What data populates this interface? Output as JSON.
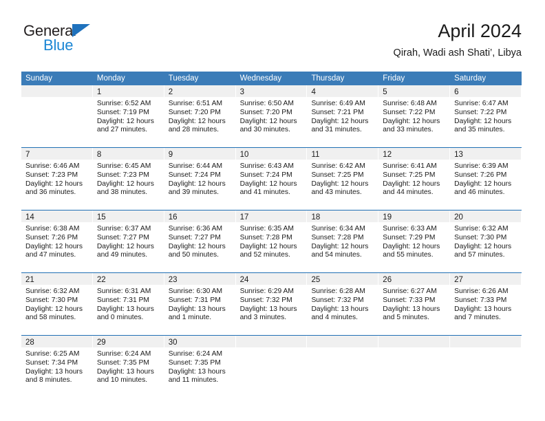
{
  "brand": {
    "name_top": "General",
    "name_bottom": "Blue",
    "triangle_color": "#1f72bd",
    "blue_text_color": "#1b86d4"
  },
  "header": {
    "title": "April 2024",
    "subtitle": "Qirah, Wadi ash Shati’, Libya"
  },
  "theme": {
    "header_bg": "#3b7cb8",
    "week_separator": "#1f6fb4",
    "day_band_bg": "#f0f0f0",
    "text": "#1a1a1a"
  },
  "weekdays": [
    "Sunday",
    "Monday",
    "Tuesday",
    "Wednesday",
    "Thursday",
    "Friday",
    "Saturday"
  ],
  "weeks": [
    [
      {
        "day": "",
        "lines": []
      },
      {
        "day": "1",
        "lines": [
          "Sunrise: 6:52 AM",
          "Sunset: 7:19 PM",
          "Daylight: 12 hours",
          "and 27 minutes."
        ]
      },
      {
        "day": "2",
        "lines": [
          "Sunrise: 6:51 AM",
          "Sunset: 7:20 PM",
          "Daylight: 12 hours",
          "and 28 minutes."
        ]
      },
      {
        "day": "3",
        "lines": [
          "Sunrise: 6:50 AM",
          "Sunset: 7:20 PM",
          "Daylight: 12 hours",
          "and 30 minutes."
        ]
      },
      {
        "day": "4",
        "lines": [
          "Sunrise: 6:49 AM",
          "Sunset: 7:21 PM",
          "Daylight: 12 hours",
          "and 31 minutes."
        ]
      },
      {
        "day": "5",
        "lines": [
          "Sunrise: 6:48 AM",
          "Sunset: 7:22 PM",
          "Daylight: 12 hours",
          "and 33 minutes."
        ]
      },
      {
        "day": "6",
        "lines": [
          "Sunrise: 6:47 AM",
          "Sunset: 7:22 PM",
          "Daylight: 12 hours",
          "and 35 minutes."
        ]
      }
    ],
    [
      {
        "day": "7",
        "lines": [
          "Sunrise: 6:46 AM",
          "Sunset: 7:23 PM",
          "Daylight: 12 hours",
          "and 36 minutes."
        ]
      },
      {
        "day": "8",
        "lines": [
          "Sunrise: 6:45 AM",
          "Sunset: 7:23 PM",
          "Daylight: 12 hours",
          "and 38 minutes."
        ]
      },
      {
        "day": "9",
        "lines": [
          "Sunrise: 6:44 AM",
          "Sunset: 7:24 PM",
          "Daylight: 12 hours",
          "and 39 minutes."
        ]
      },
      {
        "day": "10",
        "lines": [
          "Sunrise: 6:43 AM",
          "Sunset: 7:24 PM",
          "Daylight: 12 hours",
          "and 41 minutes."
        ]
      },
      {
        "day": "11",
        "lines": [
          "Sunrise: 6:42 AM",
          "Sunset: 7:25 PM",
          "Daylight: 12 hours",
          "and 43 minutes."
        ]
      },
      {
        "day": "12",
        "lines": [
          "Sunrise: 6:41 AM",
          "Sunset: 7:25 PM",
          "Daylight: 12 hours",
          "and 44 minutes."
        ]
      },
      {
        "day": "13",
        "lines": [
          "Sunrise: 6:39 AM",
          "Sunset: 7:26 PM",
          "Daylight: 12 hours",
          "and 46 minutes."
        ]
      }
    ],
    [
      {
        "day": "14",
        "lines": [
          "Sunrise: 6:38 AM",
          "Sunset: 7:26 PM",
          "Daylight: 12 hours",
          "and 47 minutes."
        ]
      },
      {
        "day": "15",
        "lines": [
          "Sunrise: 6:37 AM",
          "Sunset: 7:27 PM",
          "Daylight: 12 hours",
          "and 49 minutes."
        ]
      },
      {
        "day": "16",
        "lines": [
          "Sunrise: 6:36 AM",
          "Sunset: 7:27 PM",
          "Daylight: 12 hours",
          "and 50 minutes."
        ]
      },
      {
        "day": "17",
        "lines": [
          "Sunrise: 6:35 AM",
          "Sunset: 7:28 PM",
          "Daylight: 12 hours",
          "and 52 minutes."
        ]
      },
      {
        "day": "18",
        "lines": [
          "Sunrise: 6:34 AM",
          "Sunset: 7:28 PM",
          "Daylight: 12 hours",
          "and 54 minutes."
        ]
      },
      {
        "day": "19",
        "lines": [
          "Sunrise: 6:33 AM",
          "Sunset: 7:29 PM",
          "Daylight: 12 hours",
          "and 55 minutes."
        ]
      },
      {
        "day": "20",
        "lines": [
          "Sunrise: 6:32 AM",
          "Sunset: 7:30 PM",
          "Daylight: 12 hours",
          "and 57 minutes."
        ]
      }
    ],
    [
      {
        "day": "21",
        "lines": [
          "Sunrise: 6:32 AM",
          "Sunset: 7:30 PM",
          "Daylight: 12 hours",
          "and 58 minutes."
        ]
      },
      {
        "day": "22",
        "lines": [
          "Sunrise: 6:31 AM",
          "Sunset: 7:31 PM",
          "Daylight: 13 hours",
          "and 0 minutes."
        ]
      },
      {
        "day": "23",
        "lines": [
          "Sunrise: 6:30 AM",
          "Sunset: 7:31 PM",
          "Daylight: 13 hours",
          "and 1 minute."
        ]
      },
      {
        "day": "24",
        "lines": [
          "Sunrise: 6:29 AM",
          "Sunset: 7:32 PM",
          "Daylight: 13 hours",
          "and 3 minutes."
        ]
      },
      {
        "day": "25",
        "lines": [
          "Sunrise: 6:28 AM",
          "Sunset: 7:32 PM",
          "Daylight: 13 hours",
          "and 4 minutes."
        ]
      },
      {
        "day": "26",
        "lines": [
          "Sunrise: 6:27 AM",
          "Sunset: 7:33 PM",
          "Daylight: 13 hours",
          "and 5 minutes."
        ]
      },
      {
        "day": "27",
        "lines": [
          "Sunrise: 6:26 AM",
          "Sunset: 7:33 PM",
          "Daylight: 13 hours",
          "and 7 minutes."
        ]
      }
    ],
    [
      {
        "day": "28",
        "lines": [
          "Sunrise: 6:25 AM",
          "Sunset: 7:34 PM",
          "Daylight: 13 hours",
          "and 8 minutes."
        ]
      },
      {
        "day": "29",
        "lines": [
          "Sunrise: 6:24 AM",
          "Sunset: 7:35 PM",
          "Daylight: 13 hours",
          "and 10 minutes."
        ]
      },
      {
        "day": "30",
        "lines": [
          "Sunrise: 6:24 AM",
          "Sunset: 7:35 PM",
          "Daylight: 13 hours",
          "and 11 minutes."
        ]
      },
      {
        "day": "",
        "lines": []
      },
      {
        "day": "",
        "lines": []
      },
      {
        "day": "",
        "lines": []
      },
      {
        "day": "",
        "lines": []
      }
    ]
  ]
}
